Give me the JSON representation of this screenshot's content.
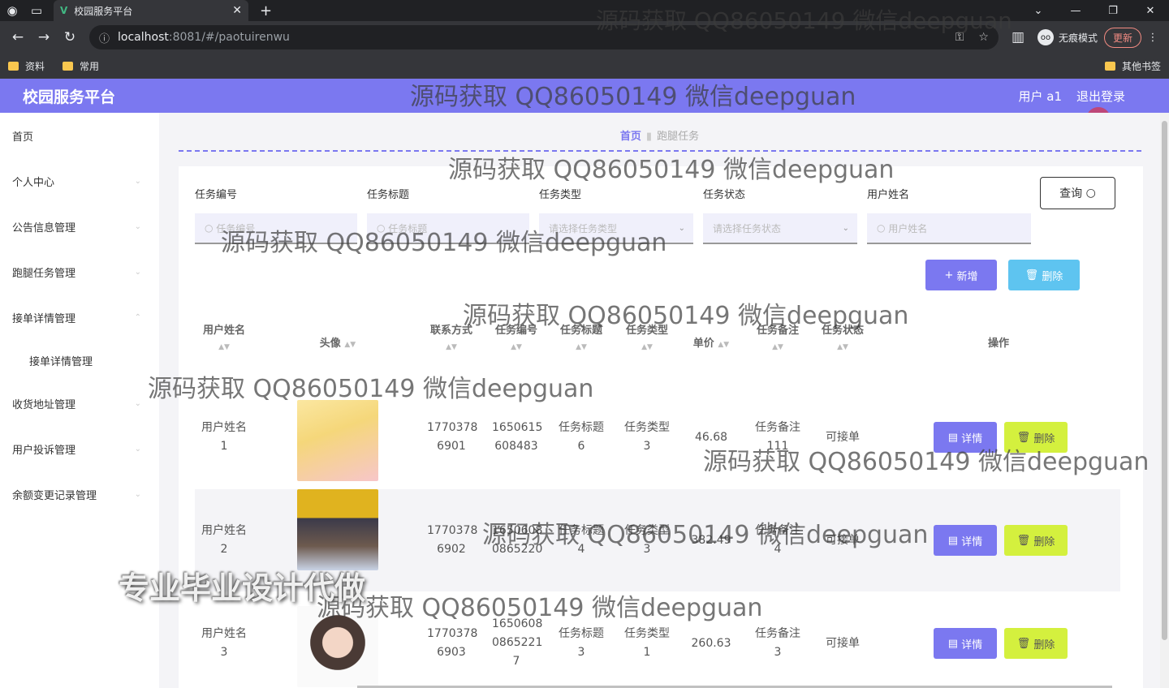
{
  "browser": {
    "tab_title": "校园服务平台",
    "url_host": "localhost",
    "url_path": ":8081/#/paotuirenwu",
    "incognito_label": "无痕模式",
    "update_label": "更新",
    "bookmarks": [
      "资料",
      "常用"
    ],
    "other_bookmarks": "其他书签"
  },
  "header": {
    "brand": "校园服务平台",
    "user": "用户 a1",
    "logout": "退出登录"
  },
  "sidebar": {
    "items": [
      {
        "label": "首页"
      },
      {
        "label": "个人中心"
      },
      {
        "label": "公告信息管理"
      },
      {
        "label": "跑腿任务管理"
      },
      {
        "label": "接单详情管理"
      },
      {
        "label": "接单详情管理"
      },
      {
        "label": "收货地址管理"
      },
      {
        "label": "用户投诉管理"
      },
      {
        "label": "余额变更记录管理"
      }
    ]
  },
  "breadcrumb": {
    "home": "首页",
    "current": "跑腿任务"
  },
  "filters": {
    "task_no": {
      "label": "任务编号",
      "placeholder": "任务编号"
    },
    "task_title": {
      "label": "任务标题",
      "placeholder": "任务标题"
    },
    "task_type": {
      "label": "任务类型",
      "placeholder": "请选择任务类型"
    },
    "task_status": {
      "label": "任务状态",
      "placeholder": "请选择任务状态"
    },
    "user_name": {
      "label": "用户姓名",
      "placeholder": "用户姓名"
    },
    "search_label": "查询"
  },
  "actions": {
    "add": "新增",
    "delete": "删除"
  },
  "table": {
    "headers": {
      "user_name": "用户姓名",
      "avatar": "头像",
      "phone": "联系方式",
      "task_no": "任务编号",
      "task_title": "任务标题",
      "task_type": "任务类型",
      "price": "单价",
      "remark": "任务备注",
      "status": "任务状态",
      "ops": "操作"
    },
    "detail_label": "详情",
    "delete_label": "删除",
    "rows": [
      {
        "name_a": "用户姓名",
        "name_b": "1",
        "phone_a": "1770378",
        "phone_b": "6901",
        "no_a": "1650615",
        "no_b": "608483",
        "no_c": "",
        "title_a": "任务标题",
        "title_b": "6",
        "type_a": "任务类型",
        "type_b": "3",
        "price": "46.68",
        "remark_a": "任务备注",
        "remark_b": "111",
        "status": "可接单",
        "avatar_color": "#f5d77a"
      },
      {
        "name_a": "用户姓名",
        "name_b": "2",
        "phone_a": "1770378",
        "phone_b": "6902",
        "no_a": "1650608",
        "no_b": "0865220",
        "no_c": "",
        "title_a": "任务标题",
        "title_b": "4",
        "type_a": "任务类型",
        "type_b": "3",
        "price": "382.49",
        "remark_a": "任务备注",
        "remark_b": "4",
        "status": "可接单",
        "avatar_color": "#e0b31f"
      },
      {
        "name_a": "用户姓名",
        "name_b": "3",
        "phone_a": "1770378",
        "phone_b": "6903",
        "no_a": "1650608",
        "no_b": "0865221",
        "no_c": "7",
        "title_a": "任务标题",
        "title_b": "3",
        "type_a": "任务类型",
        "type_b": "1",
        "price": "260.63",
        "remark_a": "任务备注",
        "remark_b": "3",
        "status": "可接单",
        "avatar_color": "#fafafa"
      }
    ]
  },
  "watermarks": {
    "text": "源码获取 QQ86050149 微信deepguan",
    "promo": "专业毕业设计代做"
  }
}
